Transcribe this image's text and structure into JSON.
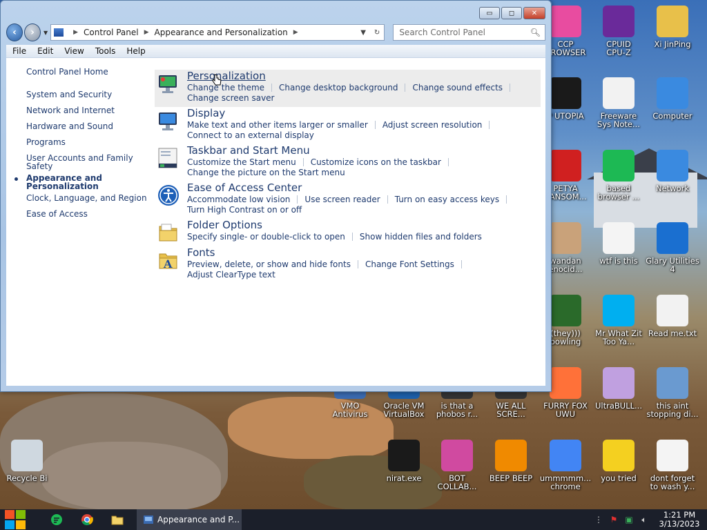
{
  "window": {
    "controls": {
      "minimize": "▭",
      "maximize": "◻",
      "close": "✕"
    },
    "breadcrumb": [
      "Control Panel",
      "Appearance and Personalization"
    ],
    "search_placeholder": "Search Control Panel",
    "menu": [
      "File",
      "Edit",
      "View",
      "Tools",
      "Help"
    ]
  },
  "leftnav": {
    "home": "Control Panel Home",
    "items": [
      "System and Security",
      "Network and Internet",
      "Hardware and Sound",
      "Programs",
      "User Accounts and Family Safety",
      "Appearance and Personalization",
      "Clock, Language, and Region",
      "Ease of Access"
    ],
    "current_index": 5
  },
  "categories": [
    {
      "title": "Personalization",
      "links": [
        "Change the theme",
        "Change desktop background",
        "Change sound effects"
      ],
      "links2": [
        "Change screen saver"
      ]
    },
    {
      "title": "Display",
      "links": [
        "Make text and other items larger or smaller",
        "Adjust screen resolution"
      ],
      "links2": [
        "Connect to an external display"
      ]
    },
    {
      "title": "Taskbar and Start Menu",
      "links": [
        "Customize the Start menu",
        "Customize icons on the taskbar"
      ],
      "links2": [
        "Change the picture on the Start menu"
      ]
    },
    {
      "title": "Ease of Access Center",
      "links": [
        "Accommodate low vision",
        "Use screen reader",
        "Turn on easy access keys"
      ],
      "links2": [
        "Turn High Contrast on or off"
      ]
    },
    {
      "title": "Folder Options",
      "links": [
        "Specify single- or double-click to open",
        "Show hidden files and folders"
      ],
      "links2": []
    },
    {
      "title": "Fonts",
      "links": [
        "Preview, delete, or show and hide fonts",
        "Change Font Settings",
        "Adjust ClearType text"
      ],
      "links2": []
    }
  ],
  "desktop_icons": [
    {
      "label": "CCP\nBROWSER",
      "icon": "ccp-browser-icon",
      "color": "#e84ca0"
    },
    {
      "label": "CPUID\nCPU-Z",
      "icon": "cpuz-icon",
      "color": "#6a2a9a"
    },
    {
      "label": "Xi JinPing",
      "icon": "folder-icon",
      "color": "#e8c04a"
    },
    {
      "label": "P UTOPIA",
      "icon": "utopia-icon",
      "color": "#1a1a1a"
    },
    {
      "label": "Freeware\nSys Note...",
      "icon": "file-icon",
      "color": "#f2f2f2"
    },
    {
      "label": "Computer",
      "icon": "computer-icon",
      "color": "#3a8ae0"
    },
    {
      "label": "PETYA\nRANSOM...",
      "icon": "skull-icon",
      "color": "#d02020"
    },
    {
      "label": "based\nbrowser ...",
      "icon": "browser-icon",
      "color": "#1db954"
    },
    {
      "label": "Network",
      "icon": "network-icon",
      "color": "#3a8ae0"
    },
    {
      "label": "wandan\nenocid...",
      "icon": "meme-icon",
      "color": "#c9a27a"
    },
    {
      "label": "wtf is this",
      "icon": "calendar-icon",
      "color": "#f4f4f4"
    },
    {
      "label": "Glary Utilities\n4",
      "icon": "glary-icon",
      "color": "#1a6fd0"
    },
    {
      "label": "(they)))\nbowling",
      "icon": "santa-icon",
      "color": "#2a6a2a"
    },
    {
      "label": "Mr What Zit\nToo Ya...",
      "icon": "skype-icon",
      "color": "#00aff0"
    },
    {
      "label": "Read me.txt",
      "icon": "text-file-icon",
      "color": "#f2f2f2"
    },
    {
      "label": "VMO\nAntivirus",
      "icon": "shield-icon",
      "color": "#3a6ab0"
    },
    {
      "label": "Oracle VM\nVirtualBox",
      "icon": "virtualbox-icon",
      "color": "#1d5fa8"
    },
    {
      "label": "is that a\nphobos r...",
      "icon": "exe-icon",
      "color": "#333"
    },
    {
      "label": "WE ALL\nSCRE...",
      "icon": "exe-icon",
      "color": "#333"
    },
    {
      "label": "FURRY FOX\nUWU",
      "icon": "firefox-icon",
      "color": "#ff7139"
    },
    {
      "label": "UltraBULL...",
      "icon": "disc-icon",
      "color": "#c0a0e0"
    },
    {
      "label": "this aint\nstopping di...",
      "icon": "installer-icon",
      "color": "#6a9ad0"
    },
    {
      "label": "Recycle Bi",
      "icon": "recycle-bin-icon",
      "color": "#cfd8e0"
    },
    {
      "label": "nirat.exe",
      "icon": "skull-icon",
      "color": "#1a1a1a"
    },
    {
      "label": "BOT\nCOLLAB...",
      "icon": "monitor-icon",
      "color": "#d04aa0"
    },
    {
      "label": "BEEP BEEP",
      "icon": "vlc-icon",
      "color": "#f08a00"
    },
    {
      "label": "ummmmm...\nchrome",
      "icon": "chrome-icon",
      "color": "#4285f4"
    },
    {
      "label": "you tried",
      "icon": "star-icon",
      "color": "#f4d020"
    },
    {
      "label": "dont forget\nto wash y...",
      "icon": "calendar-icon",
      "color": "#f4f4f4"
    }
  ],
  "taskbar": {
    "task_label": "Appearance and P...",
    "time": "1:21 PM",
    "date": "3/13/2023"
  }
}
